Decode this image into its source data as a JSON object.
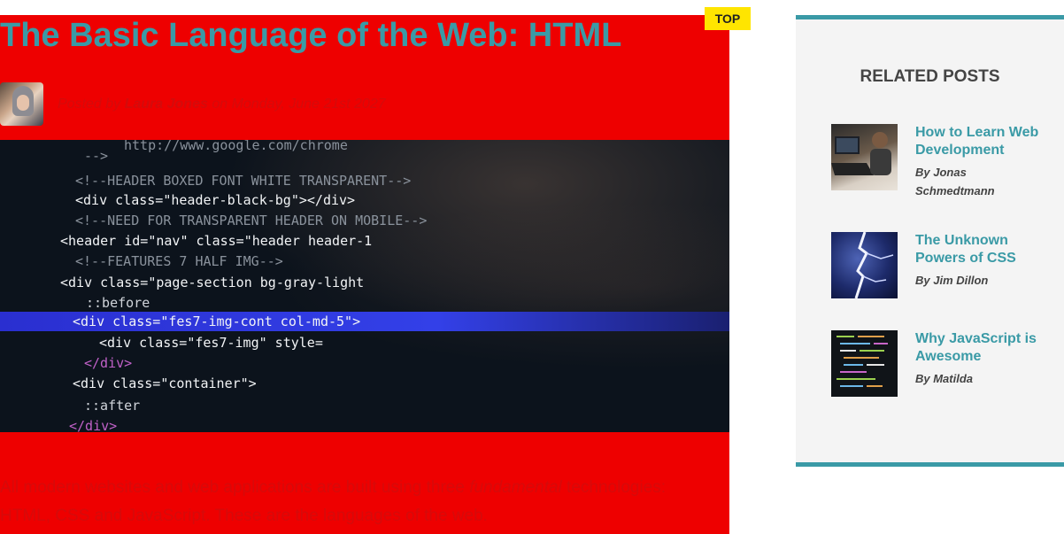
{
  "article": {
    "title": "The Basic Language of the Web: HTML",
    "top_badge": "TOP",
    "byline_prefix": "Posted by ",
    "author": "Laura Jones",
    "byline_middle": " on ",
    "date": "Monday, June 21st 2027",
    "excerpt_1": "All modern websites and web applications are built using three ",
    "excerpt_em": "fundamental",
    "excerpt_2": " technologies: HTML, CSS and JavaScript. These are the languages of the web."
  },
  "hero_code": [
    {
      "text": "http://www.google.com/chrome"
    },
    {
      "text": "-->"
    },
    {
      "text": "<!--HEADER BOXED FONT WHITE TRANSPARENT-->"
    },
    {
      "text": "<div class=\"header-black-bg\"></div>"
    },
    {
      "text": "<!--NEED FOR TRANSPARENT HEADER ON MOBILE-->"
    },
    {
      "text": "<header id=\"nav\" class=\"header header-1"
    },
    {
      "text": "<!--FEATURES 7 HALF IMG-->"
    },
    {
      "text": "<div class=\"page-section bg-gray-light"
    },
    {
      "text": "::before"
    },
    {
      "text": "<div class=\"fes7-img-cont col-md-5\">"
    },
    {
      "text": "<div class=\"fes7-img\" style="
    },
    {
      "text": "</div>"
    },
    {
      "text": "<div class=\"container\">"
    },
    {
      "text": "::after"
    },
    {
      "text": "</div>"
    }
  ],
  "sidebar": {
    "title": "RELATED POSTS",
    "posts": [
      {
        "title": "How to Learn Web Development",
        "author": "By Jonas Schmedtmann"
      },
      {
        "title": "The Unknown Powers of CSS",
        "author": "By Jim Dillon"
      },
      {
        "title": "Why JavaScript is Awesome",
        "author": "By Matilda"
      }
    ]
  },
  "colors": {
    "accent": "#3a9aa6",
    "article_bg": "#ee0000",
    "badge": "#ffe500",
    "sidebar_bg": "#f4f4f4"
  }
}
